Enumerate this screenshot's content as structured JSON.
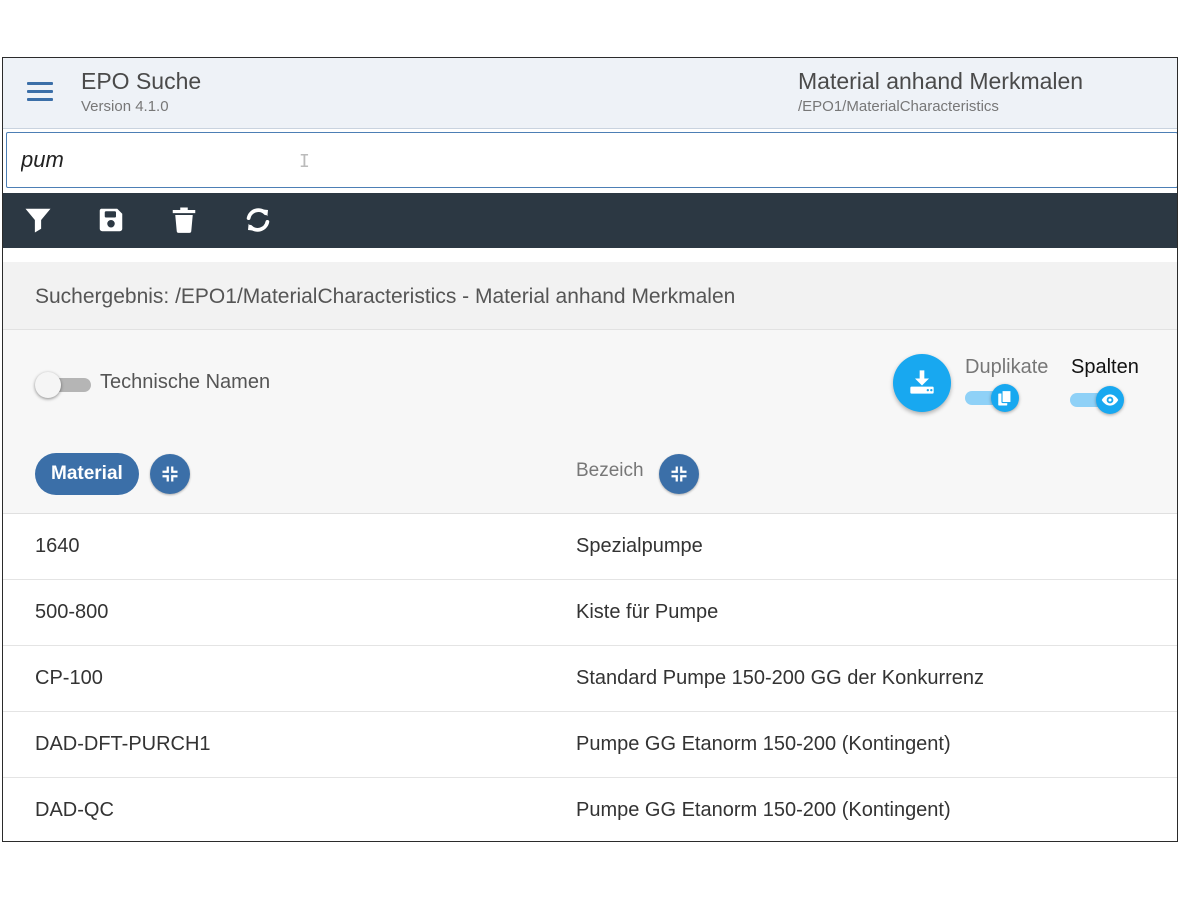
{
  "header": {
    "app_title": "EPO Suche",
    "app_version": "Version 4.1.0",
    "page_title": "Material anhand Merkmalen",
    "page_path": "/EPO1/MaterialCharacteristics",
    "accent_color": "#3b6fa8"
  },
  "search": {
    "value": "pum"
  },
  "toolbar": {
    "icons": [
      "filter-icon",
      "save-icon",
      "delete-icon",
      "refresh-icon"
    ],
    "background": "#2c3843"
  },
  "results": {
    "title": "Suchergebnis: /EPO1/MaterialCharacteristics - Material anhand Merkmalen",
    "technical_names_label": "Technische Namen",
    "technical_names_on": false,
    "duplicates_label": "Duplikate",
    "duplicates_on": true,
    "columns_label": "Spalten",
    "columns_on": true,
    "download_color": "#18a8f0"
  },
  "table": {
    "columns": [
      "Material",
      "Bezeich"
    ],
    "rows": [
      {
        "material": "1640",
        "bezeichnung": "Spezialpumpe"
      },
      {
        "material": "500-800",
        "bezeichnung": "Kiste für Pumpe"
      },
      {
        "material": "CP-100",
        "bezeichnung": "Standard Pumpe 150-200 GG der Konkurrenz"
      },
      {
        "material": "DAD-DFT-PURCH1",
        "bezeichnung": "Pumpe GG Etanorm 150-200 (Kontingent)"
      },
      {
        "material": "DAD-QC",
        "bezeichnung": "Pumpe GG Etanorm 150-200 (Kontingent)"
      }
    ]
  }
}
